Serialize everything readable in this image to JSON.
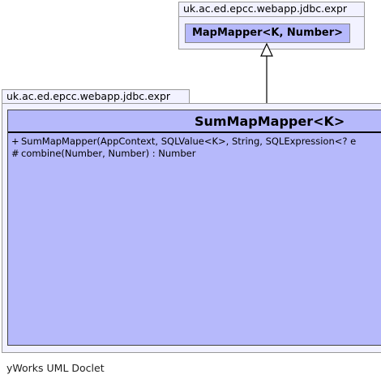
{
  "parent_package": {
    "name": "uk.ac.ed.epcc.webapp.jdbc.expr"
  },
  "parent_class": {
    "name": "MapMapper<K, Number>"
  },
  "child_package": {
    "name": "uk.ac.ed.epcc.webapp.jdbc.expr"
  },
  "child_class": {
    "name": "SumMapMapper<K>",
    "members": [
      {
        "visibility": "+",
        "signature": "SumMapMapper(AppContext, SQLValue<K>, String, SQLExpression<? e"
      },
      {
        "visibility": "#",
        "signature": "combine(Number, Number) : Number"
      }
    ]
  },
  "relationship": {
    "type": "generalization"
  },
  "footer": {
    "text": "yWorks UML Doclet"
  }
}
